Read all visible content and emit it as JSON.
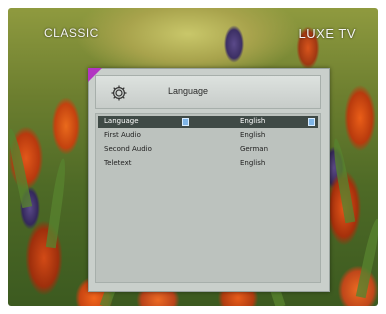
{
  "overlay": {
    "channel_left": "CLASSIC",
    "channel_right": "LUXE TV"
  },
  "menu": {
    "title": "Language",
    "icon": "gear-icon",
    "accent_color": "#b235c2",
    "items": [
      {
        "label": "Language",
        "value": "English",
        "selected": true
      },
      {
        "label": "First Audio",
        "value": "English",
        "selected": false
      },
      {
        "label": "Second Audio",
        "value": "German",
        "selected": false
      },
      {
        "label": "Teletext",
        "value": "English",
        "selected": false
      }
    ]
  }
}
